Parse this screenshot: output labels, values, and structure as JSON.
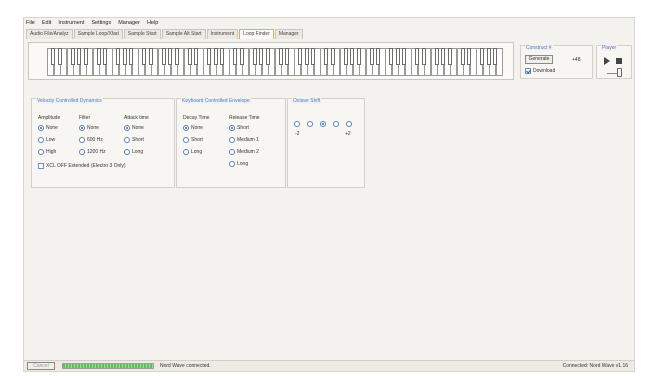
{
  "menu": [
    "File",
    "Edit",
    "Instrument",
    "Settings",
    "Manager",
    "Help"
  ],
  "tabs": [
    "Audio File/Analyz",
    "Sample Loop/Xfad",
    "Sample Start",
    "Sample Alt Start",
    "Instrument",
    "Loop Finder",
    "Manager"
  ],
  "active_tab": 5,
  "keyboard": {
    "white_keys": 70
  },
  "construct": {
    "title": "Construct #",
    "generate_label": "Generate",
    "value": "+48",
    "download_label": "Download",
    "download_checked": true
  },
  "player": {
    "title": "Player"
  },
  "velocity": {
    "title": "Velocity Controlled Dynamics",
    "columns": [
      {
        "header": "Amplitude",
        "options": [
          "None",
          "Low",
          "High"
        ],
        "selected": 0
      },
      {
        "header": "Filter",
        "options": [
          "None",
          "600 Hz",
          "1200 Hz"
        ],
        "selected": 0
      },
      {
        "header": "Attack time",
        "options": [
          "None",
          "Short",
          "Long"
        ],
        "selected": 0
      }
    ],
    "checkbox_label": "XCL OFF Extended (Electro 3 Only)"
  },
  "keyboard_env": {
    "title": "Keyboard Controlled Envelope",
    "columns": [
      {
        "header": "Decay Time",
        "options": [
          "None",
          "Short",
          "Long"
        ],
        "selected": 0
      },
      {
        "header": "Release Time",
        "options": [
          "Short",
          "Medium 1",
          "Medium 2",
          "Long"
        ],
        "selected": 0
      }
    ]
  },
  "octave": {
    "title": "Octave Shift",
    "count": 5,
    "selected": 2,
    "min_label": "-2",
    "max_label": "+2"
  },
  "status": {
    "cancel_label": "Cancel",
    "progress": 1.0,
    "message": "Nord Wave connected.",
    "connection": "Connected: Nord Wave v1.16"
  },
  "colors": {
    "accent": "#4a78c8",
    "progress": "#5fbf5f",
    "active_tab_border": "#e0a860"
  }
}
